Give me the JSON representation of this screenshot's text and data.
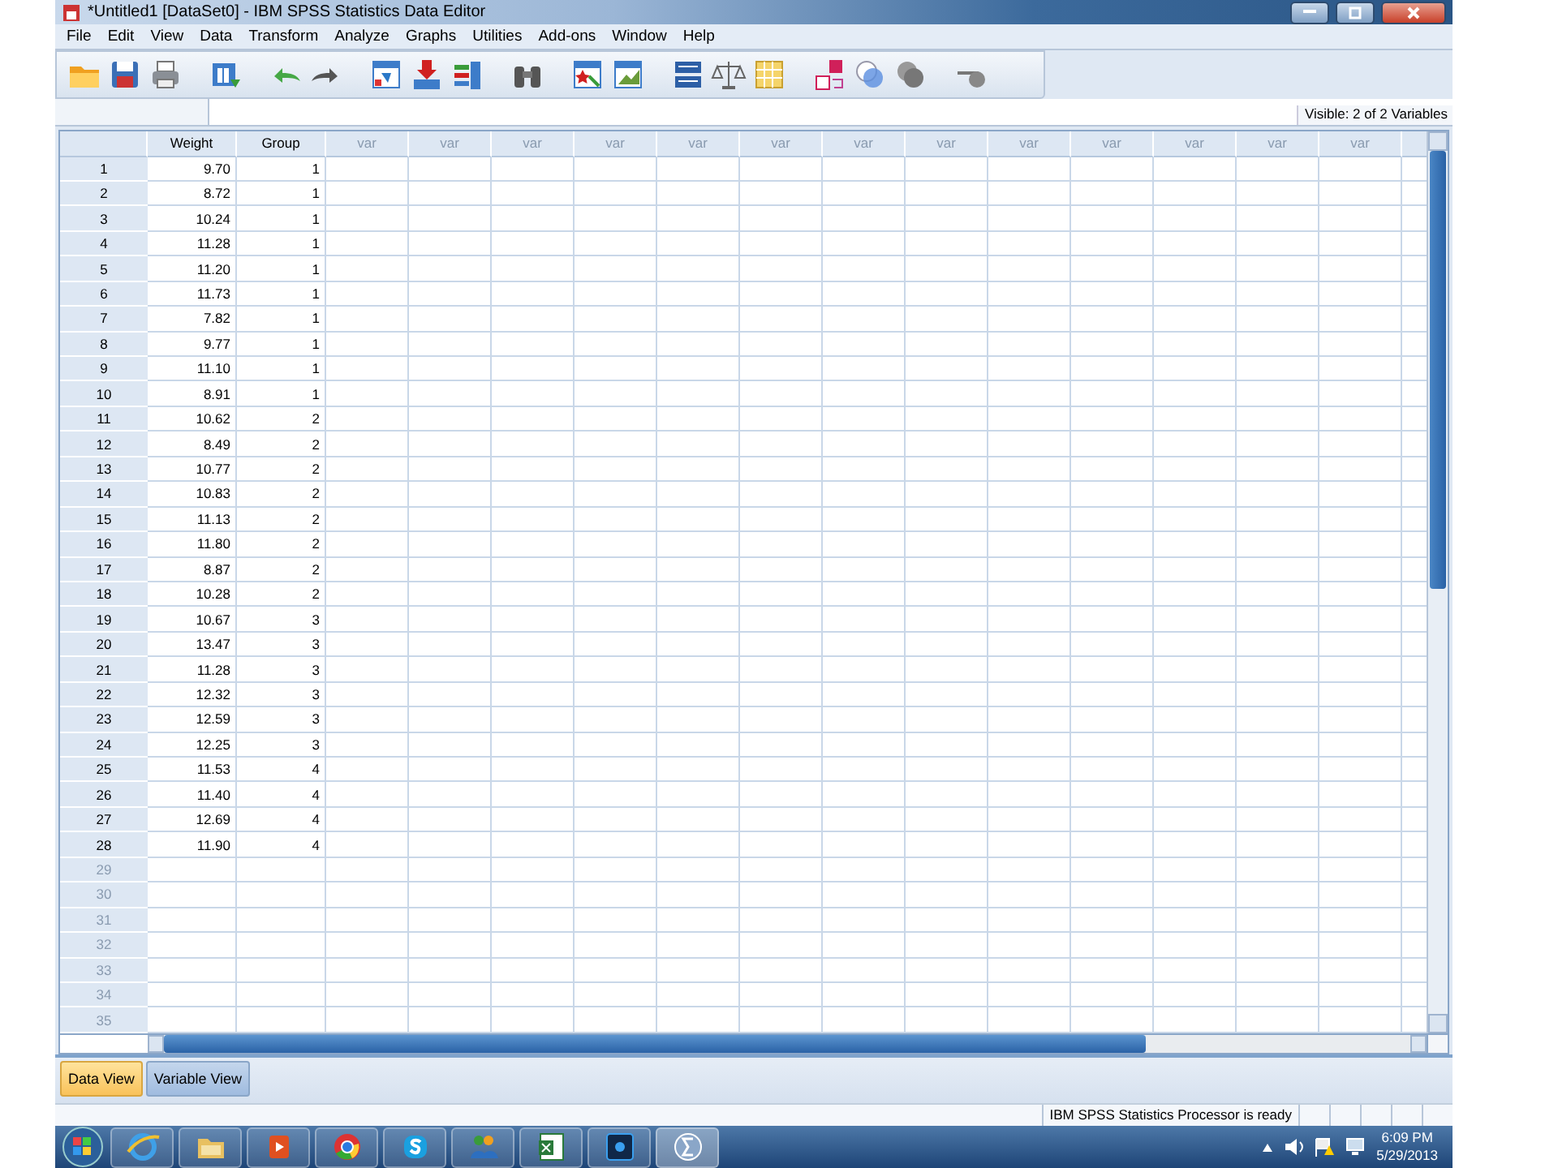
{
  "window": {
    "title": "*Untitled1 [DataSet0] - IBM SPSS Statistics Data Editor"
  },
  "menu": [
    "File",
    "Edit",
    "View",
    "Data",
    "Transform",
    "Analyze",
    "Graphs",
    "Utilities",
    "Add-ons",
    "Window",
    "Help"
  ],
  "visible_label": "Visible: 2 of 2 Variables",
  "columns": [
    {
      "name": "Weight",
      "defined": true
    },
    {
      "name": "Group",
      "defined": true
    },
    {
      "name": "var",
      "defined": false
    },
    {
      "name": "var",
      "defined": false
    },
    {
      "name": "var",
      "defined": false
    },
    {
      "name": "var",
      "defined": false
    },
    {
      "name": "var",
      "defined": false
    },
    {
      "name": "var",
      "defined": false
    },
    {
      "name": "var",
      "defined": false
    },
    {
      "name": "var",
      "defined": false
    },
    {
      "name": "var",
      "defined": false
    },
    {
      "name": "var",
      "defined": false
    },
    {
      "name": "var",
      "defined": false
    },
    {
      "name": "var",
      "defined": false
    },
    {
      "name": "var",
      "defined": false
    }
  ],
  "rows": [
    {
      "number": "1",
      "cells": [
        "9.70",
        "1"
      ]
    },
    {
      "number": "2",
      "cells": [
        "8.72",
        "1"
      ]
    },
    {
      "number": "3",
      "cells": [
        "10.24",
        "1"
      ]
    },
    {
      "number": "4",
      "cells": [
        "11.28",
        "1"
      ]
    },
    {
      "number": "5",
      "cells": [
        "11.20",
        "1"
      ]
    },
    {
      "number": "6",
      "cells": [
        "11.73",
        "1"
      ]
    },
    {
      "number": "7",
      "cells": [
        "7.82",
        "1"
      ]
    },
    {
      "number": "8",
      "cells": [
        "9.77",
        "1"
      ]
    },
    {
      "number": "9",
      "cells": [
        "11.10",
        "1"
      ]
    },
    {
      "number": "10",
      "cells": [
        "8.91",
        "1"
      ]
    },
    {
      "number": "11",
      "cells": [
        "10.62",
        "2"
      ]
    },
    {
      "number": "12",
      "cells": [
        "8.49",
        "2"
      ]
    },
    {
      "number": "13",
      "cells": [
        "10.77",
        "2"
      ]
    },
    {
      "number": "14",
      "cells": [
        "10.83",
        "2"
      ]
    },
    {
      "number": "15",
      "cells": [
        "11.13",
        "2"
      ]
    },
    {
      "number": "16",
      "cells": [
        "11.80",
        "2"
      ]
    },
    {
      "number": "17",
      "cells": [
        "8.87",
        "2"
      ]
    },
    {
      "number": "18",
      "cells": [
        "10.28",
        "2"
      ]
    },
    {
      "number": "19",
      "cells": [
        "10.67",
        "3"
      ]
    },
    {
      "number": "20",
      "cells": [
        "13.47",
        "3"
      ]
    },
    {
      "number": "21",
      "cells": [
        "11.28",
        "3"
      ]
    },
    {
      "number": "22",
      "cells": [
        "12.32",
        "3"
      ]
    },
    {
      "number": "23",
      "cells": [
        "12.59",
        "3"
      ]
    },
    {
      "number": "24",
      "cells": [
        "12.25",
        "3"
      ]
    },
    {
      "number": "25",
      "cells": [
        "11.53",
        "4"
      ]
    },
    {
      "number": "26",
      "cells": [
        "11.40",
        "4"
      ]
    },
    {
      "number": "27",
      "cells": [
        "12.69",
        "4"
      ]
    },
    {
      "number": "28",
      "cells": [
        "11.90",
        "4"
      ]
    },
    {
      "number": "29"
    },
    {
      "number": "30"
    },
    {
      "number": "31"
    },
    {
      "number": "32"
    },
    {
      "number": "33"
    },
    {
      "number": "34"
    },
    {
      "number": "35"
    }
  ],
  "tabs": [
    {
      "label": "Data View",
      "selected": true
    },
    {
      "label": "Variable View",
      "selected": false
    }
  ],
  "status_bar": "IBM SPSS Statistics Processor is ready",
  "clock": {
    "time": "6:09 PM",
    "date": "5/29/2013"
  }
}
